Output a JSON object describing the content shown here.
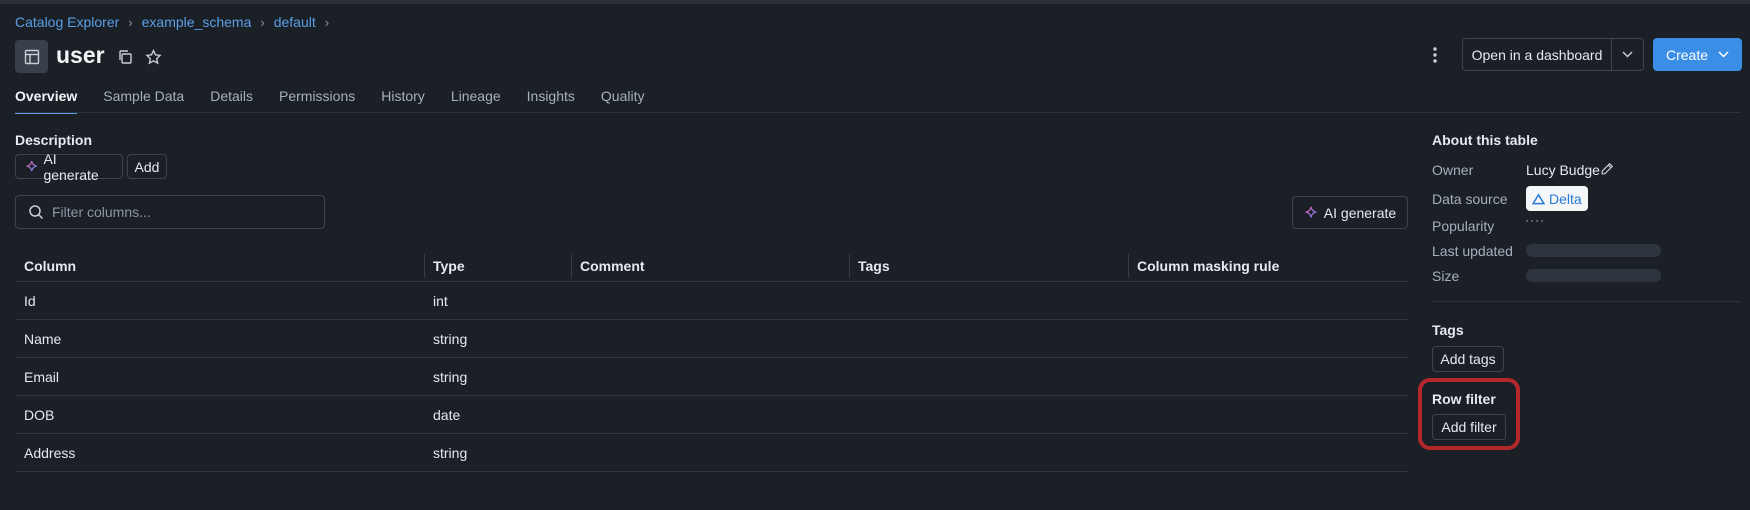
{
  "breadcrumb": [
    "Catalog Explorer",
    "example_schema",
    "default"
  ],
  "page_title": "user",
  "header": {
    "open_dashboard": "Open in a dashboard",
    "create": "Create"
  },
  "tabs": [
    "Overview",
    "Sample Data",
    "Details",
    "Permissions",
    "History",
    "Lineage",
    "Insights",
    "Quality"
  ],
  "active_tab": "Overview",
  "description": {
    "label": "Description",
    "ai_generate": "AI generate",
    "add": "Add"
  },
  "filter": {
    "placeholder": "Filter columns..."
  },
  "ai_generate_button": "AI generate",
  "table": {
    "headers": [
      "Column",
      "Type",
      "Comment",
      "Tags",
      "Column masking rule"
    ],
    "rows": [
      {
        "column": "Id",
        "type": "int"
      },
      {
        "column": "Name",
        "type": "string"
      },
      {
        "column": "Email",
        "type": "string"
      },
      {
        "column": "DOB",
        "type": "date"
      },
      {
        "column": "Address",
        "type": "string"
      }
    ]
  },
  "about": {
    "title": "About this table",
    "owner_label": "Owner",
    "owner_value": "Lucy Budge",
    "datasource_label": "Data source",
    "datasource_value": "Delta",
    "popularity_label": "Popularity",
    "last_updated_label": "Last updated",
    "size_label": "Size"
  },
  "tags": {
    "label": "Tags",
    "add": "Add tags"
  },
  "row_filter": {
    "label": "Row filter",
    "add": "Add filter"
  },
  "colors": {
    "accent": "#3a8ee6",
    "link": "#5b9fe6",
    "highlight": "#b3282a",
    "background": "#1b1f26"
  }
}
